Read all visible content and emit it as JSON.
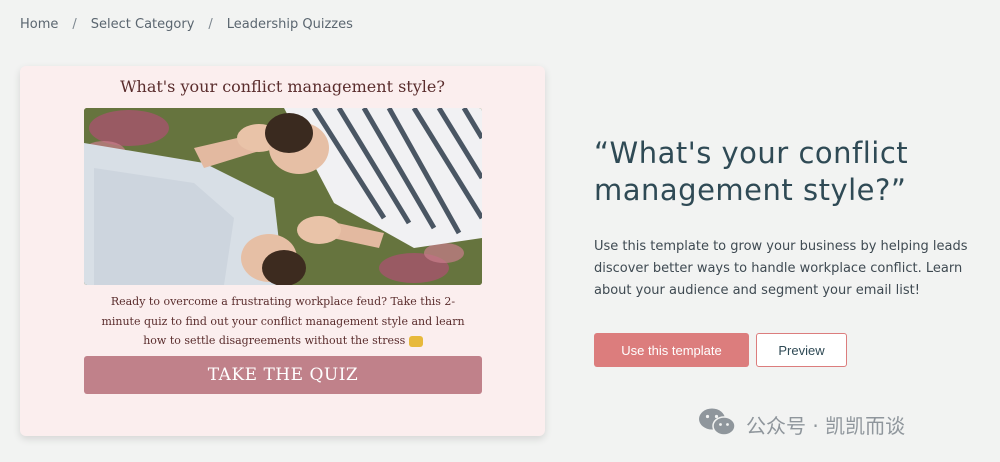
{
  "breadcrumb": {
    "items": [
      "Home",
      "Select Category",
      "Leadership Quizzes"
    ],
    "separator": "/"
  },
  "quiz_card": {
    "title": "What's your conflict management style?",
    "image": "photo-of-two-people-lying-in-grass-covering-faces",
    "description": "Ready to overcome a frustrating workplace feud? Take this 2-minute quiz to find out your conflict management style and learn how to settle disagreements without the stress",
    "description_emoji": "raising-hands-emoji",
    "cta_label": "TAKE THE QUIZ",
    "background": "#fbeeee",
    "cta_color": "#c0818a"
  },
  "template_info": {
    "headline": "“What's your conflict management style?”",
    "description": "Use this template to grow your business by helping leads discover better ways to handle workplace conflict. Learn about your audience and segment your email list!",
    "use_template_label": "Use this template",
    "preview_label": "Preview",
    "accent_color": "#dc7d7d"
  },
  "watermark": {
    "text": "公众号 · 凯凯而谈",
    "icon": "wechat-icon"
  }
}
